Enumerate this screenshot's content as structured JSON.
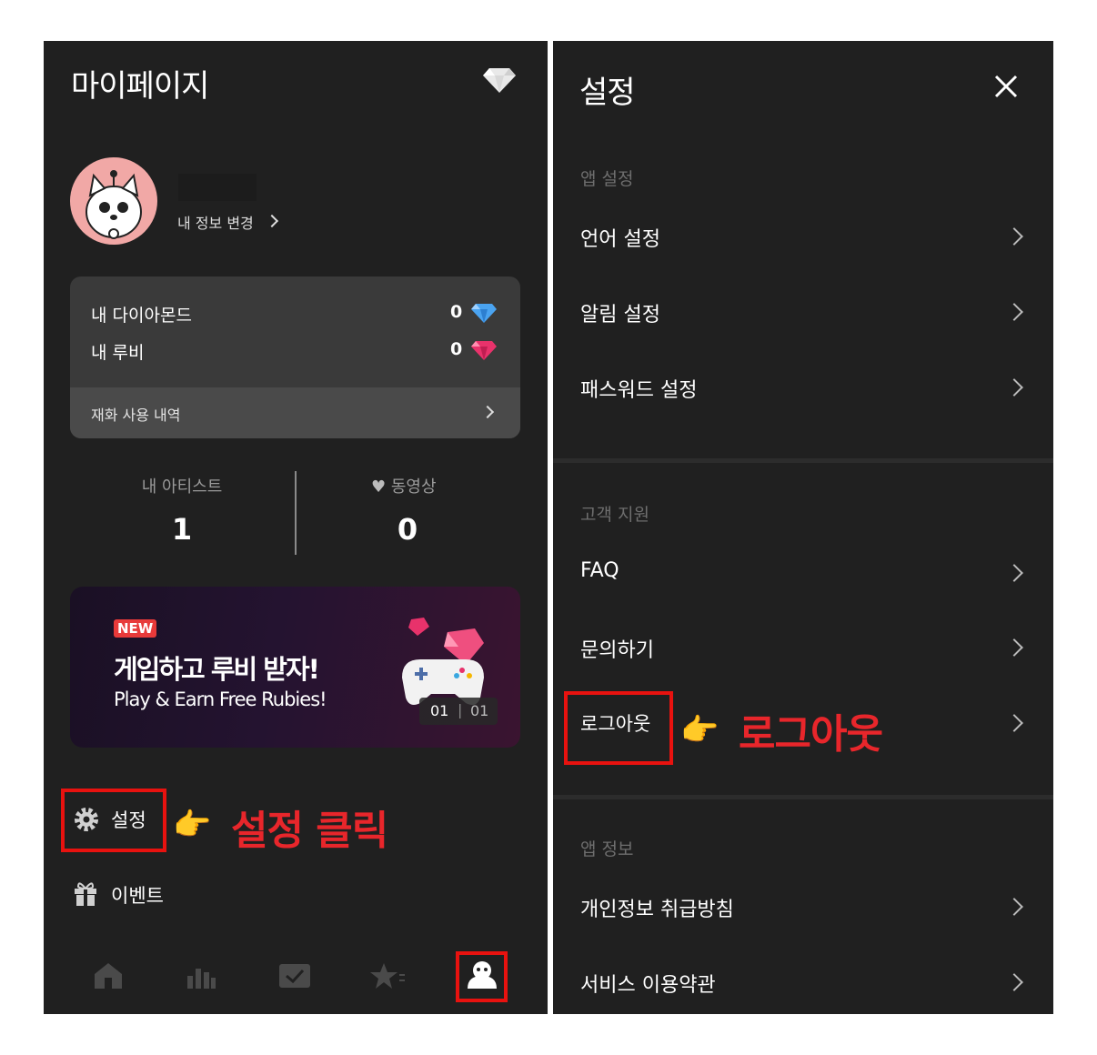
{
  "left": {
    "header": {
      "title": "마이페이지"
    },
    "profile": {
      "edit_label": "내 정보 변경"
    },
    "currency": {
      "diamond_label": "내 다이아몬드",
      "diamond_value": "0",
      "ruby_label": "내 루비",
      "ruby_value": "0",
      "history_label": "재화 사용 내역"
    },
    "stats": {
      "artist_label": "내 아티스트",
      "artist_value": "1",
      "video_label": "동영상",
      "video_value": "0"
    },
    "banner": {
      "badge": "NEW",
      "headline": "게임하고 루비 받자!",
      "subline": "Play & Earn Free Rubies!",
      "page_current": "01",
      "page_total": "01"
    },
    "menu": {
      "settings": "설정",
      "events": "이벤트"
    },
    "annotation": "설정 클릭"
  },
  "right": {
    "header": {
      "title": "설정"
    },
    "sections": [
      {
        "label": "앱 설정",
        "items": [
          "언어 설정",
          "알림 설정",
          "패스워드 설정"
        ]
      },
      {
        "label": "고객 지원",
        "items": [
          "FAQ",
          "문의하기",
          "로그아웃"
        ]
      },
      {
        "label": "앱 정보",
        "items": [
          "개인정보 취급방침",
          "서비스 이용약관"
        ]
      }
    ],
    "annotation": "로그아웃"
  },
  "colors": {
    "panel_bg": "#202020",
    "card_bg": "#3a3a3a",
    "highlight_red": "#e8120f",
    "accent_pink": "#e8326b"
  },
  "icons": [
    "diamond-icon",
    "close-icon",
    "gear-icon",
    "gift-icon",
    "home-icon",
    "chart-icon",
    "check-icon",
    "star-icon",
    "profile-icon",
    "pointing-hand-icon"
  ]
}
